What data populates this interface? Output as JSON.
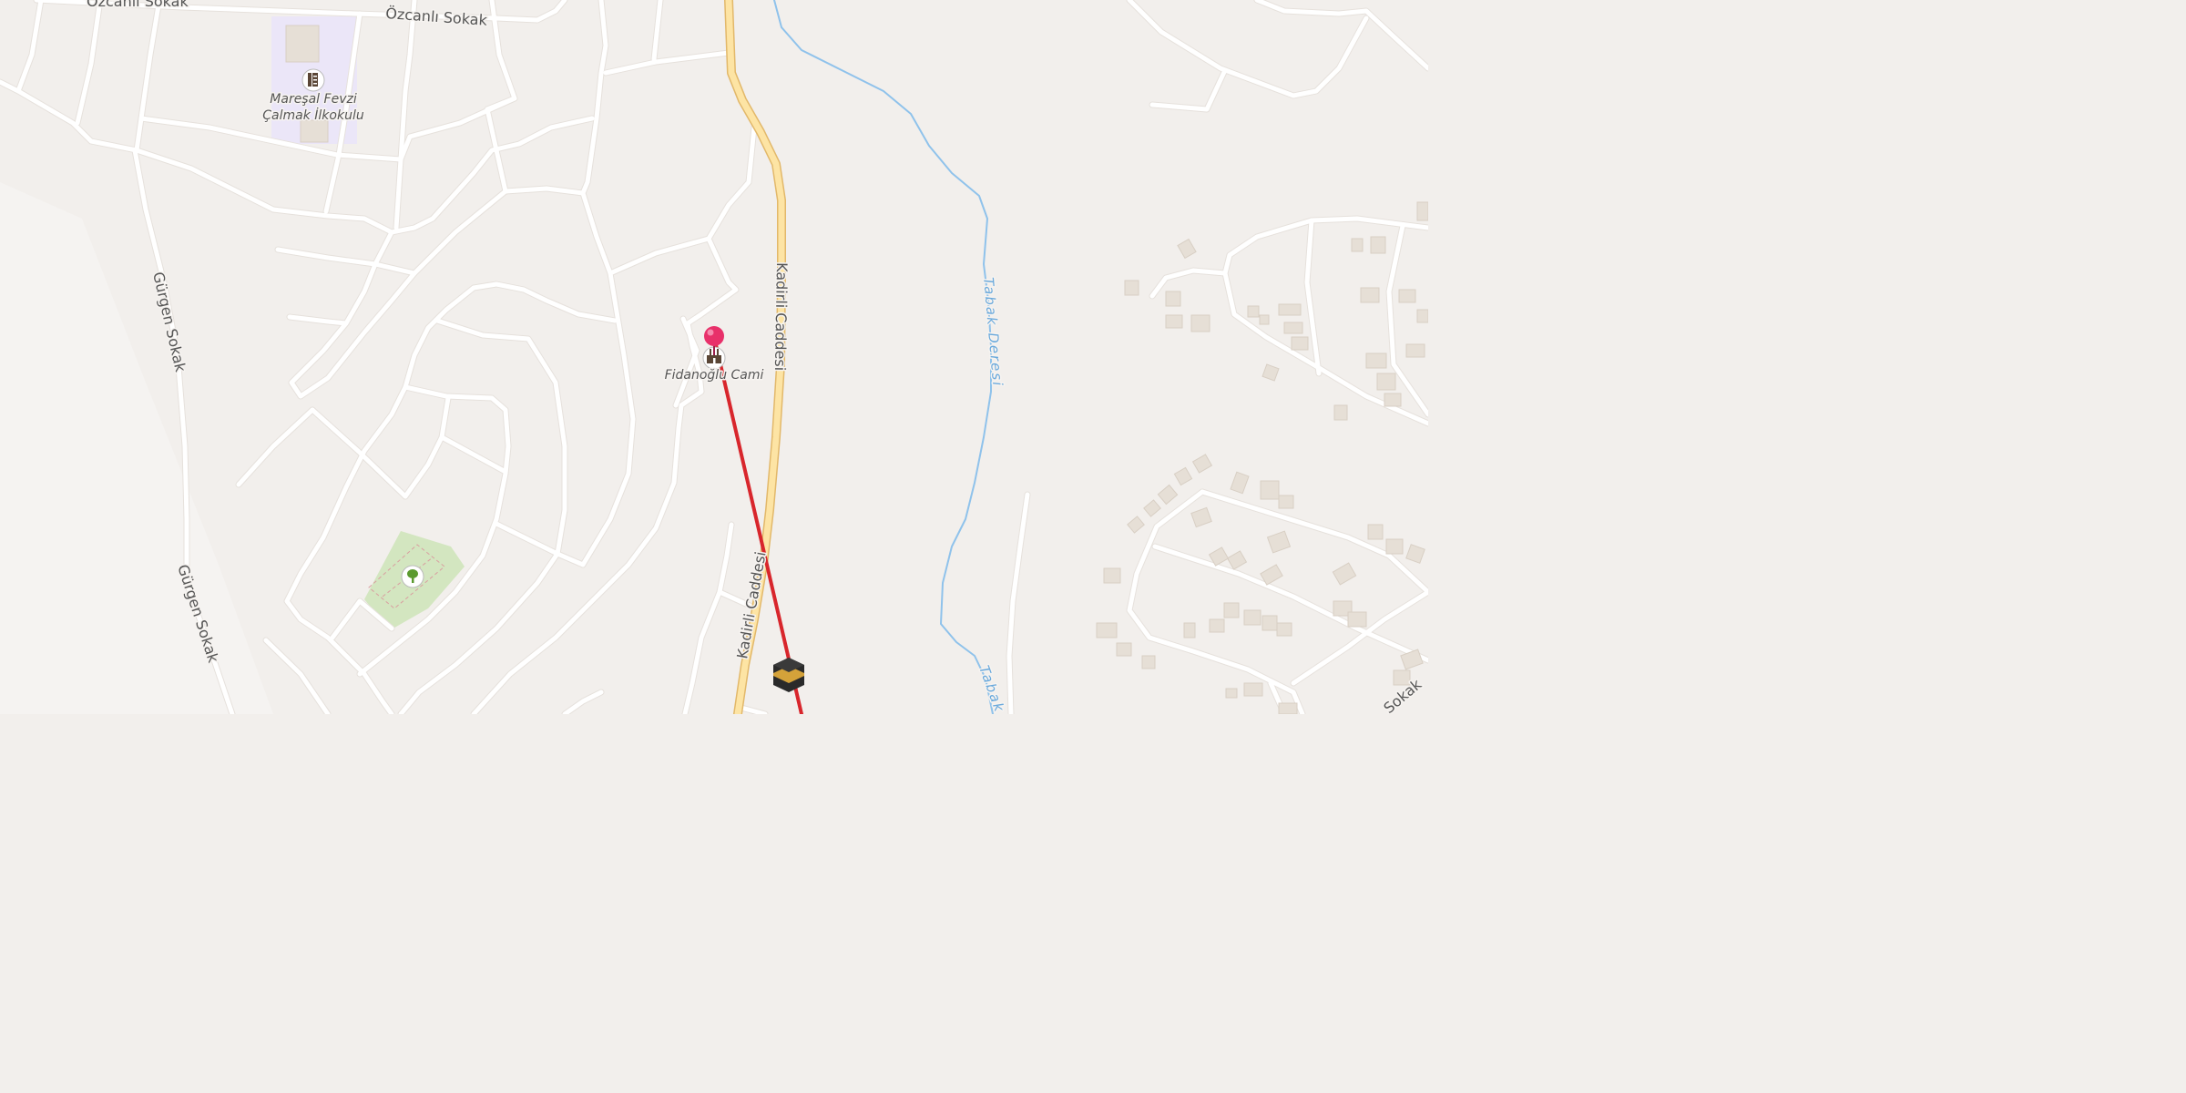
{
  "map": {
    "streets": {
      "ozcanli_1": "Özcanlı Sokak",
      "ozcanli_2": "Özcanlı Sokak",
      "gurgen_1": "Gürgen Sokak",
      "gurgen_2": "Gürgen Sokak",
      "kadirli_1": "Kadirli Caddesi",
      "kadirli_2": "Kadirli Caddesi",
      "right_edge": "Sokak"
    },
    "water": {
      "tabak_1": "Tabak Deresi",
      "tabak_2": "Tabak"
    },
    "pois": {
      "school_line1": "Mareşal Fevzi",
      "school_line2": "Çalmak İlkokulu",
      "mosque": "Fidanoğlu Cami"
    },
    "icons": {
      "school": "school-icon",
      "mosque": "mosque-icon",
      "park": "tree-icon",
      "kaaba": "kaaba-icon",
      "pin": "location-pin-icon"
    },
    "colors": {
      "qibla_line": "#d8262c",
      "pin": "#e8306a",
      "primary_road": "#fde4a4",
      "stream": "#8fc2eb",
      "park": "#d3e6c0",
      "school_area": "#ebe6f8"
    }
  }
}
